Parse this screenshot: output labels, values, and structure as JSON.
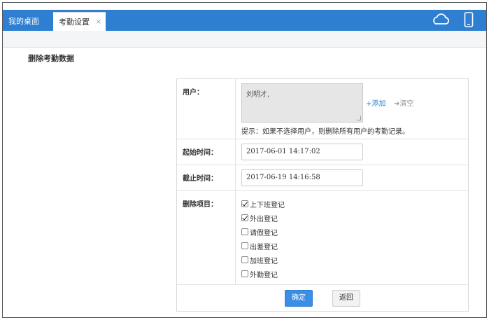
{
  "tabs": [
    {
      "label": "我的桌面"
    },
    {
      "label": "考勤设置",
      "close": "×"
    }
  ],
  "icons": {
    "cloud": "cloud-icon",
    "phone": "phone-icon"
  },
  "colors": {
    "topbar": "#2e7fd1",
    "primary_button": "#3a8ee6"
  },
  "page": {
    "title": "删除考勤数据"
  },
  "form": {
    "user": {
      "label": "用户：",
      "value": "刘明才,",
      "add_label": "+添加",
      "clear_label": "清空",
      "hint": "提示：如果不选择用户，则删除所有用户的考勤记录。"
    },
    "start_time": {
      "label": "起始时间：",
      "value": "2017-06-01 14:17:02"
    },
    "end_time": {
      "label": "截止时间：",
      "value": "2017-06-19 14:16:58"
    },
    "items": {
      "label": "删除项目：",
      "options": [
        {
          "label": "上下班登记",
          "checked": true
        },
        {
          "label": "外出登记",
          "checked": true
        },
        {
          "label": "请假登记",
          "checked": false
        },
        {
          "label": "出差登记",
          "checked": false
        },
        {
          "label": "加班登记",
          "checked": false
        },
        {
          "label": "外勤登记",
          "checked": false
        }
      ]
    },
    "ok_label": "确定",
    "back_label": "返回"
  }
}
